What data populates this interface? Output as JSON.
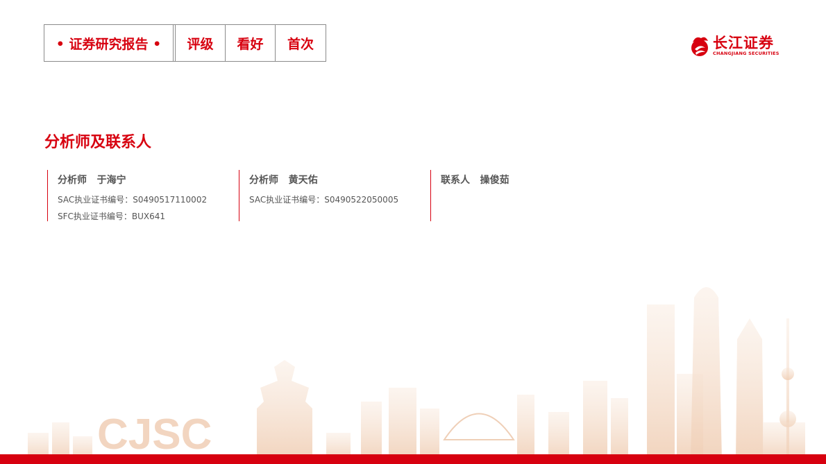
{
  "header": {
    "report_type": "• 证券研究报告 •",
    "rating_label": "评级",
    "rating_value": "看好",
    "coverage": "首次"
  },
  "logo": {
    "cn": "长江证券",
    "en": "CHANGJIANG SECURITIES",
    "icon": "changjiang-securities-logo-icon"
  },
  "section_title": "分析师及联系人",
  "contacts": [
    {
      "name": "分析师   于海宁",
      "lines": [
        "SAC执业证书编号：S0490517110002",
        "SFC执业证书编号：BUX641"
      ]
    },
    {
      "name": "分析师   黄天佑",
      "lines": [
        "SAC执业证书编号：S0490522050005"
      ]
    },
    {
      "name": "联系人   操俊茹",
      "lines": []
    }
  ],
  "decoration": {
    "watermark_text": "CJSC",
    "accent_color": "#d7000f",
    "skyline_color": "#f3d9c4"
  }
}
